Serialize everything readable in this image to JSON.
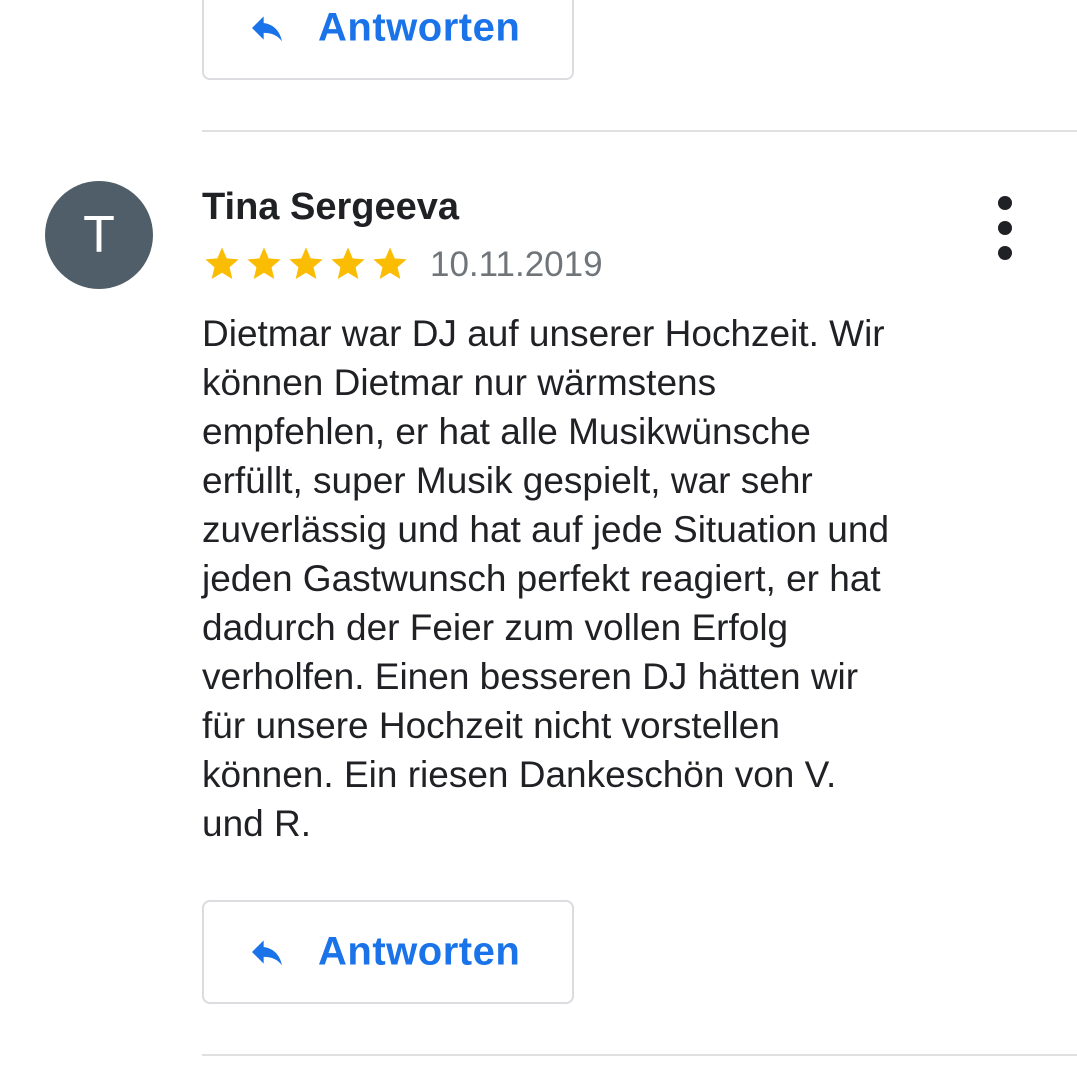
{
  "reply_button_label": "Antworten",
  "review": {
    "author_initial": "T",
    "author_name": "Tina Sergeeva",
    "rating": 5,
    "rating_max": 5,
    "date": "10.11.2019",
    "text_lines": [
      "Dietmar war DJ auf unserer Hochzeit. Wir",
      "können Dietmar nur wärmstens",
      "empfehlen, er hat alle Musikwünsche",
      "erfüllt, super Musik gespielt, war sehr",
      "zuverlässig und hat auf jede Situation und",
      "jeden Gastwunsch perfekt reagiert, er hat",
      "dadurch der Feier zum vollen Erfolg",
      "verholfen. Einen besseren DJ hätten wir",
      "für unsere Hochzeit nicht vorstellen",
      "können. Ein riesen Dankeschön von V.",
      "und R."
    ]
  },
  "icons": {
    "reply": "reply-arrow-icon",
    "star": "star-icon",
    "more": "more-vertical-icon"
  },
  "colors": {
    "accent": "#1a73e8",
    "star": "#fbbc04",
    "avatar_bg": "#4f5e68",
    "divider": "#e0e0e0",
    "button_border": "#dadce0",
    "secondary_text": "#70757a",
    "primary_text": "#202124"
  }
}
